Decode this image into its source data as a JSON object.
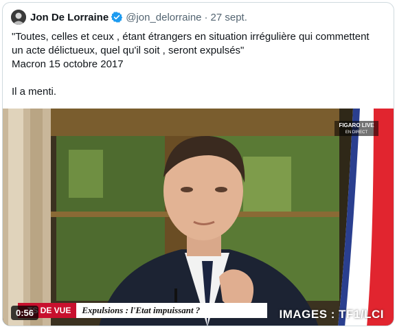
{
  "tweet": {
    "author": {
      "display_name": "Jon De Lorraine",
      "handle": "@jon_delorraine",
      "separator": "·",
      "date": "27 sept.",
      "verified_icon": "verified-badge-icon",
      "verified_color": "#1d9bf0"
    },
    "text_lines": [
      "\"Toutes, celles et ceux , étant étrangers en situation irrégulière qui commettent",
      "un acte délictueux, quel qu'il soit , seront expulsés\"",
      "Macron 15 octobre 2017",
      "",
      "Il a menti."
    ]
  },
  "video": {
    "duration": "0:56",
    "channel_logo": [
      "FIGARO LIVE",
      "EN DIRECT"
    ],
    "banner_left": "TS DE VUE",
    "banner_right": "Expulsions : l'Etat impuissant ?",
    "credit": "IMAGES : TF1/LCI",
    "banner_color": "#c8102e"
  }
}
